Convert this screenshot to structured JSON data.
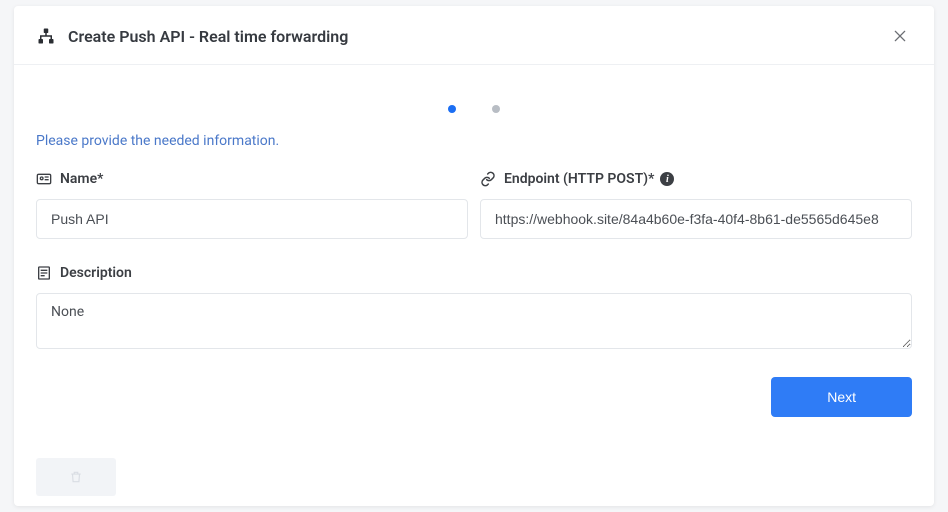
{
  "header": {
    "title": "Create Push API - Real time forwarding"
  },
  "stepper": {
    "active_index": 0,
    "total": 2
  },
  "instruction": "Please provide the needed information.",
  "fields": {
    "name": {
      "label": "Name*",
      "value": "Push API"
    },
    "endpoint": {
      "label": "Endpoint (HTTP POST)*",
      "value": "https://webhook.site/84a4b60e-f3fa-40f4-8b61-de5565d645e8"
    },
    "description": {
      "label": "Description",
      "value": "None"
    }
  },
  "buttons": {
    "next": "Next"
  }
}
